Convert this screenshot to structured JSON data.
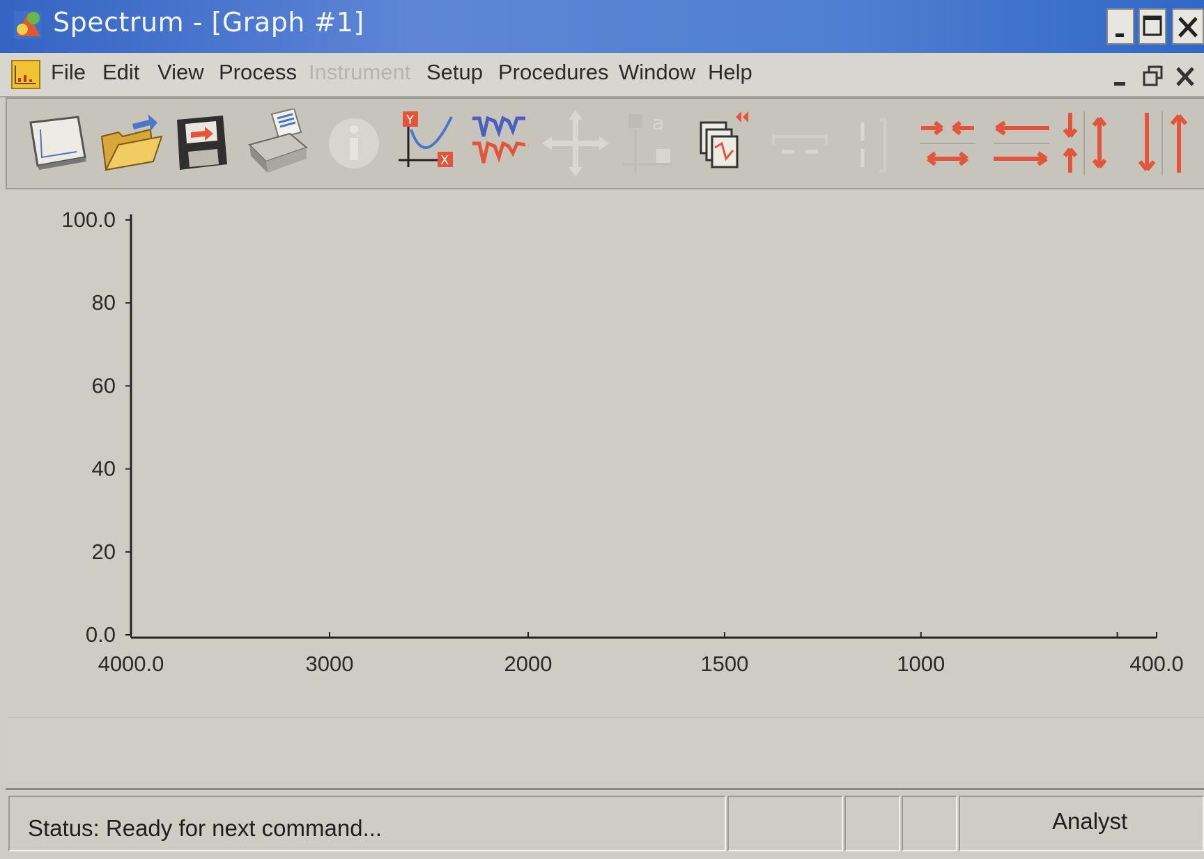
{
  "window": {
    "title": "Spectrum - [Graph #1]"
  },
  "menu": {
    "items": [
      {
        "label": "File",
        "enabled": true
      },
      {
        "label": "Edit",
        "enabled": true
      },
      {
        "label": "View",
        "enabled": true
      },
      {
        "label": "Process",
        "enabled": true
      },
      {
        "label": "Instrument",
        "enabled": false
      },
      {
        "label": "Setup",
        "enabled": true
      },
      {
        "label": "Procedures",
        "enabled": true
      },
      {
        "label": "Window",
        "enabled": true
      },
      {
        "label": "Help",
        "enabled": true
      }
    ]
  },
  "toolbar": {
    "tools": [
      {
        "icon": "new-graph-icon",
        "enabled": true
      },
      {
        "icon": "open-folder-icon",
        "enabled": true
      },
      {
        "icon": "save-disk-icon",
        "enabled": true
      },
      {
        "icon": "print-icon",
        "enabled": true
      },
      {
        "icon": "info-icon",
        "enabled": false
      },
      {
        "icon": "xy-axes-icon",
        "enabled": true
      },
      {
        "icon": "overlay-spectra-icon",
        "enabled": true
      },
      {
        "icon": "move-cross-icon",
        "enabled": false
      },
      {
        "icon": "label-peaks-icon",
        "enabled": false
      },
      {
        "icon": "copy-graph-icon",
        "enabled": true
      },
      {
        "icon": "horizontal-range-icon",
        "enabled": false
      },
      {
        "icon": "vertical-range-icon",
        "enabled": false
      },
      {
        "icon": "expand-horizontal-icon",
        "enabled": true
      },
      {
        "icon": "scroll-horizontal-icon",
        "enabled": true
      },
      {
        "icon": "expand-vertical-icon",
        "enabled": true
      },
      {
        "icon": "scroll-vertical-icon",
        "enabled": true
      }
    ],
    "accent_color": "#e2553a"
  },
  "chart_data": {
    "type": "line",
    "title": "",
    "xlabel": "",
    "ylabel": "",
    "xlim": [
      4000.0,
      400.0
    ],
    "ylim": [
      0.0,
      100.0
    ],
    "x_ticks": [
      4000,
      3000,
      2000,
      1500,
      1000,
      400
    ],
    "x_tick_labels": [
      "4000.0",
      "3000",
      "2000",
      "1500",
      "1000",
      "400.0"
    ],
    "y_ticks": [
      0,
      20,
      40,
      60,
      80,
      100
    ],
    "y_tick_labels": [
      "0.0",
      "20",
      "40",
      "60",
      "80",
      "100.0"
    ],
    "x_scale_note": "axis scale changes at 2000 (half-scale below 2000)",
    "series": [],
    "grid": false
  },
  "status": {
    "text": "Status: Ready for next command...",
    "user": "Analyst"
  }
}
